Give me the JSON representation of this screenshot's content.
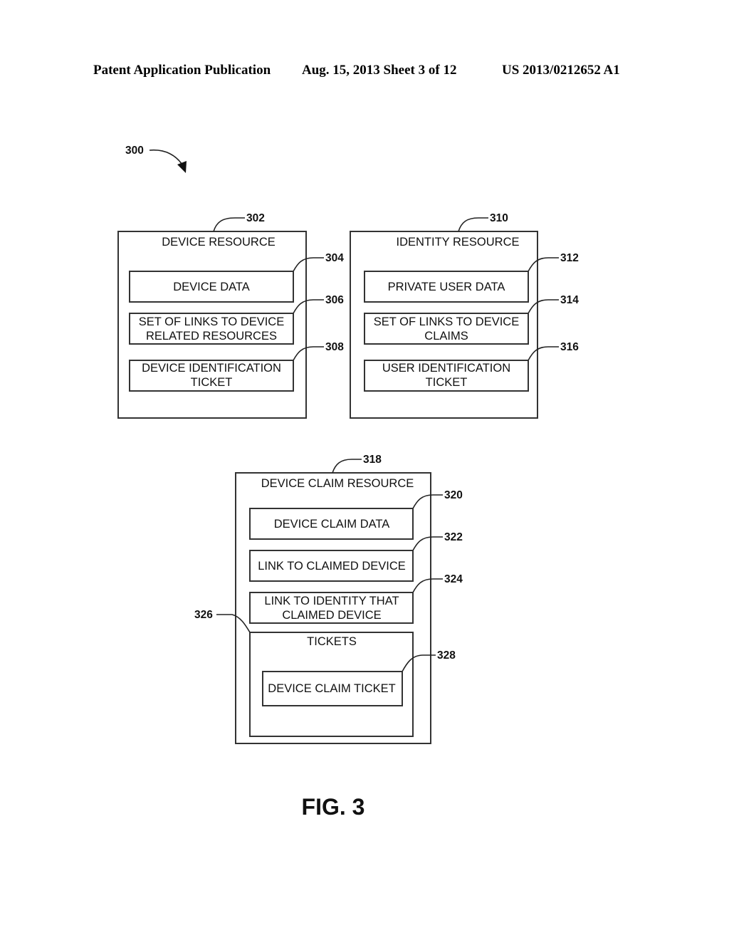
{
  "header": {
    "left": "Patent Application Publication",
    "middle": "Aug. 15, 2013  Sheet 3 of 12",
    "right": "US 2013/0212652 A1"
  },
  "figure": {
    "ref": "300",
    "caption": "FIG. 3",
    "boxes": [
      {
        "id": "device-resource",
        "ref": "302",
        "title": "DEVICE RESOURCE",
        "items": [
          {
            "ref": "304",
            "lines": [
              "DEVICE DATA"
            ]
          },
          {
            "ref": "306",
            "lines": [
              "SET OF LINKS TO DEVICE",
              "RELATED RESOURCES"
            ]
          },
          {
            "ref": "308",
            "lines": [
              "DEVICE IDENTIFICATION",
              "TICKET"
            ]
          }
        ]
      },
      {
        "id": "identity-resource",
        "ref": "310",
        "title": "IDENTITY RESOURCE",
        "items": [
          {
            "ref": "312",
            "lines": [
              "PRIVATE USER DATA"
            ]
          },
          {
            "ref": "314",
            "lines": [
              "SET OF LINKS TO DEVICE",
              "CLAIMS"
            ]
          },
          {
            "ref": "316",
            "lines": [
              "USER IDENTIFICATION",
              "TICKET"
            ]
          }
        ]
      },
      {
        "id": "device-claim-resource",
        "ref": "318",
        "title": "DEVICE CLAIM RESOURCE",
        "items": [
          {
            "ref": "320",
            "lines": [
              "DEVICE CLAIM DATA"
            ]
          },
          {
            "ref": "322",
            "lines": [
              "LINK TO CLAIMED DEVICE"
            ]
          },
          {
            "ref": "324",
            "lines": [
              "LINK TO IDENTITY THAT",
              "CLAIMED DEVICE"
            ]
          }
        ],
        "tickets": {
          "ref": "326",
          "title": "TICKETS",
          "item": {
            "ref": "328",
            "lines": [
              "DEVICE CLAIM TICKET"
            ]
          }
        }
      }
    ]
  }
}
